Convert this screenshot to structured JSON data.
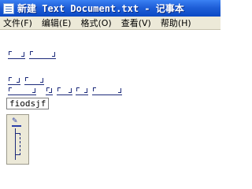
{
  "window": {
    "title": "新建 Text Document.txt - 记事本"
  },
  "menu": [
    {
      "label": "文件(F)"
    },
    {
      "label": "编辑(E)"
    },
    {
      "label": "格式(O)"
    },
    {
      "label": "查看(V)"
    },
    {
      "label": "帮助(H)"
    }
  ],
  "editor": {
    "ime_composition": "fiodsjf"
  },
  "colors": {
    "titlebar": "#1f5fd8",
    "menubar": "#ece9d8",
    "script_ink": "#1c2a7a"
  },
  "icons": {
    "app": "notepad-icon",
    "ime": "ime-logo-icon"
  }
}
